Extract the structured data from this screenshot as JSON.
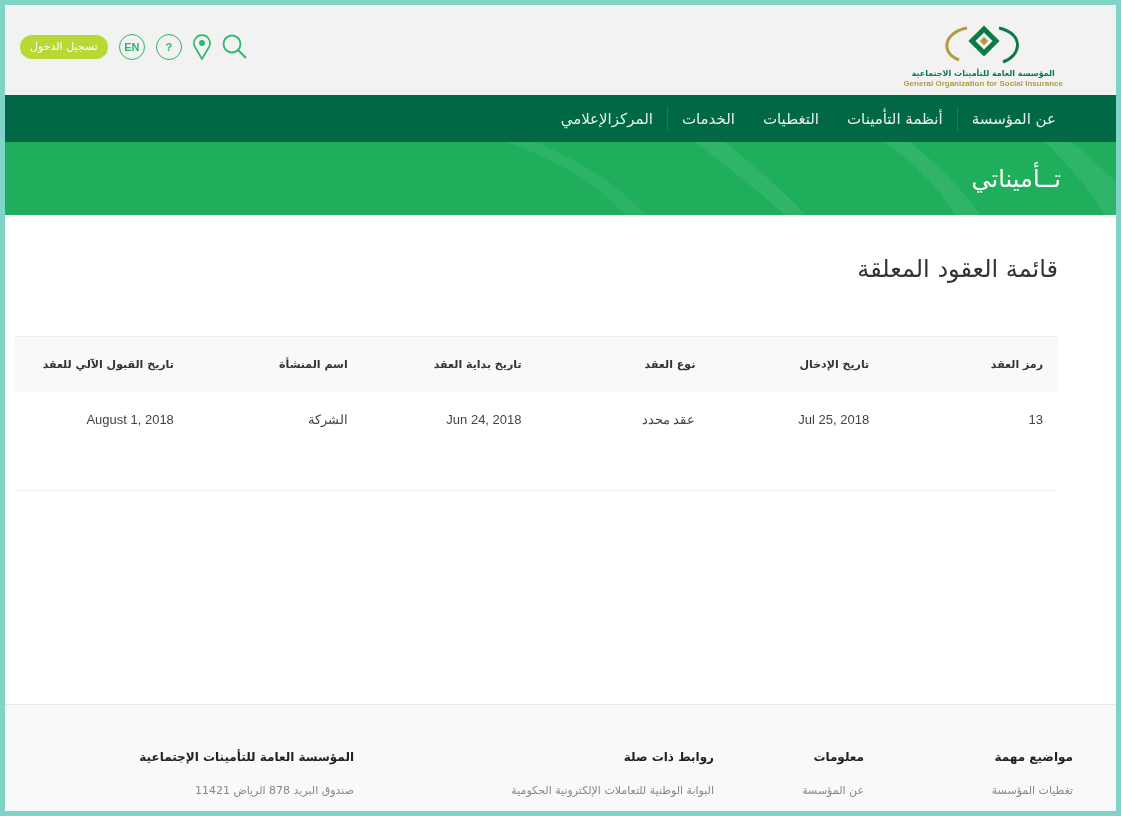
{
  "header": {
    "logo": {
      "arabic": "المؤسسة العامة للتأمينات الاجتماعية",
      "english": "General Organization for Social Insurance"
    },
    "login_button": "تسجيل الدخول",
    "language_button": "EN",
    "help_button": "?"
  },
  "nav": {
    "items": [
      {
        "label": "عن المؤسسة"
      },
      {
        "label": "أنظمة التأمينات"
      },
      {
        "label": "التغطيات"
      },
      {
        "label": "الخدمات"
      },
      {
        "label": "المركزالإعلامي"
      }
    ]
  },
  "banner": {
    "title": "تــأميناتي"
  },
  "page_title": "قائمة العقود المعلقة",
  "table": {
    "columns": [
      "رمز العقد",
      "تاريخ الإدخال",
      "نوع العقد",
      "تاريخ بداية العقد",
      "اسم المنشأة",
      "تاريخ القبول الآلي للعقد"
    ],
    "rows": [
      [
        "13",
        "Jul 25, 2018",
        "عقد محدد",
        "Jun 24, 2018",
        "الشركة",
        "August 1, 2018"
      ]
    ]
  },
  "footer": {
    "columns": [
      {
        "heading": "مواضيع مهمة",
        "links": [
          "تغطيات المؤسسة"
        ]
      },
      {
        "heading": "معلومات",
        "links": [
          "عن المؤسسة"
        ]
      },
      {
        "heading": "روابط ذات صلة",
        "links": [
          "البوابة الوطنية للتعاملات الإلكترونية الحكومية"
        ]
      },
      {
        "heading": "المؤسسة العامة للتأمينات الإجتماعية",
        "links": [
          "صندوق البريد 878 الرياض 11421"
        ]
      }
    ]
  }
}
